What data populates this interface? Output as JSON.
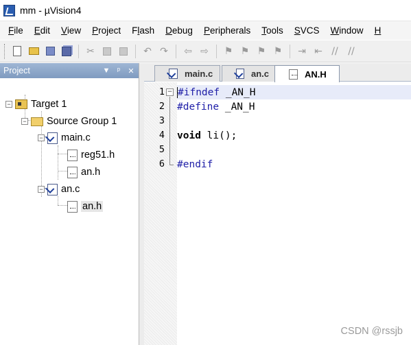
{
  "window": {
    "title": "mm  - µVision4",
    "icon": "uvision-icon"
  },
  "menu": [
    {
      "label": "File",
      "underline": "F",
      "rest": "ile"
    },
    {
      "label": "Edit",
      "underline": "E",
      "rest": "dit"
    },
    {
      "label": "View",
      "underline": "V",
      "rest": "iew"
    },
    {
      "label": "Project",
      "underline": "P",
      "rest": "roject"
    },
    {
      "label": "Flash",
      "pre": "F",
      "underline": "l",
      "rest": "ash"
    },
    {
      "label": "Debug",
      "underline": "D",
      "rest": "ebug"
    },
    {
      "label": "Peripherals",
      "underline": "P",
      "rest": "eripherals"
    },
    {
      "label": "Tools",
      "underline": "T",
      "rest": "ools"
    },
    {
      "label": "SVCS",
      "underline": "S",
      "rest": "VCS"
    },
    {
      "label": "Window",
      "underline": "W",
      "rest": "indow"
    },
    {
      "label": "Help",
      "underline": "H",
      "rest": ""
    }
  ],
  "toolbar": {
    "buttons": [
      "new-file-icon",
      "open-folder-icon",
      "save-icon",
      "save-all-icon",
      "cut-icon",
      "copy-icon",
      "paste-icon",
      "undo-icon",
      "redo-icon",
      "nav-back-icon",
      "nav-forward-icon",
      "bookmark-toggle-icon",
      "bookmark-prev-icon",
      "bookmark-next-icon",
      "bookmark-clear-icon",
      "indent-icon",
      "unindent-icon",
      "comment-icon",
      "uncomment-icon"
    ]
  },
  "project_panel": {
    "title": "Project",
    "pin_glyph": "▼ ᵖ ×",
    "tree": {
      "target": "Target 1",
      "group": "Source Group 1",
      "file1": "main.c",
      "file1_child1": "reg51.h",
      "file1_child2": "an.h",
      "file2": "an.c",
      "file2_child1": "an.h"
    }
  },
  "editor": {
    "tabs": [
      {
        "label": "main.c",
        "active": false
      },
      {
        "label": "an.c",
        "active": false
      },
      {
        "label": "AN.H",
        "active": true
      }
    ],
    "lines": [
      {
        "num": "1",
        "text_pre": "#ifndef",
        "text_rest": " _AN_H"
      },
      {
        "num": "2",
        "text_pre": "#define",
        "text_rest": " _AN_H"
      },
      {
        "num": "3",
        "text_pre": "",
        "text_rest": ""
      },
      {
        "num": "4",
        "text_kw": "void",
        "text_rest": " li();"
      },
      {
        "num": "5",
        "text_pre": "",
        "text_rest": ""
      },
      {
        "num": "6",
        "text_pre": "#endif",
        "text_rest": ""
      }
    ]
  },
  "watermark": "CSDN @rssjb"
}
